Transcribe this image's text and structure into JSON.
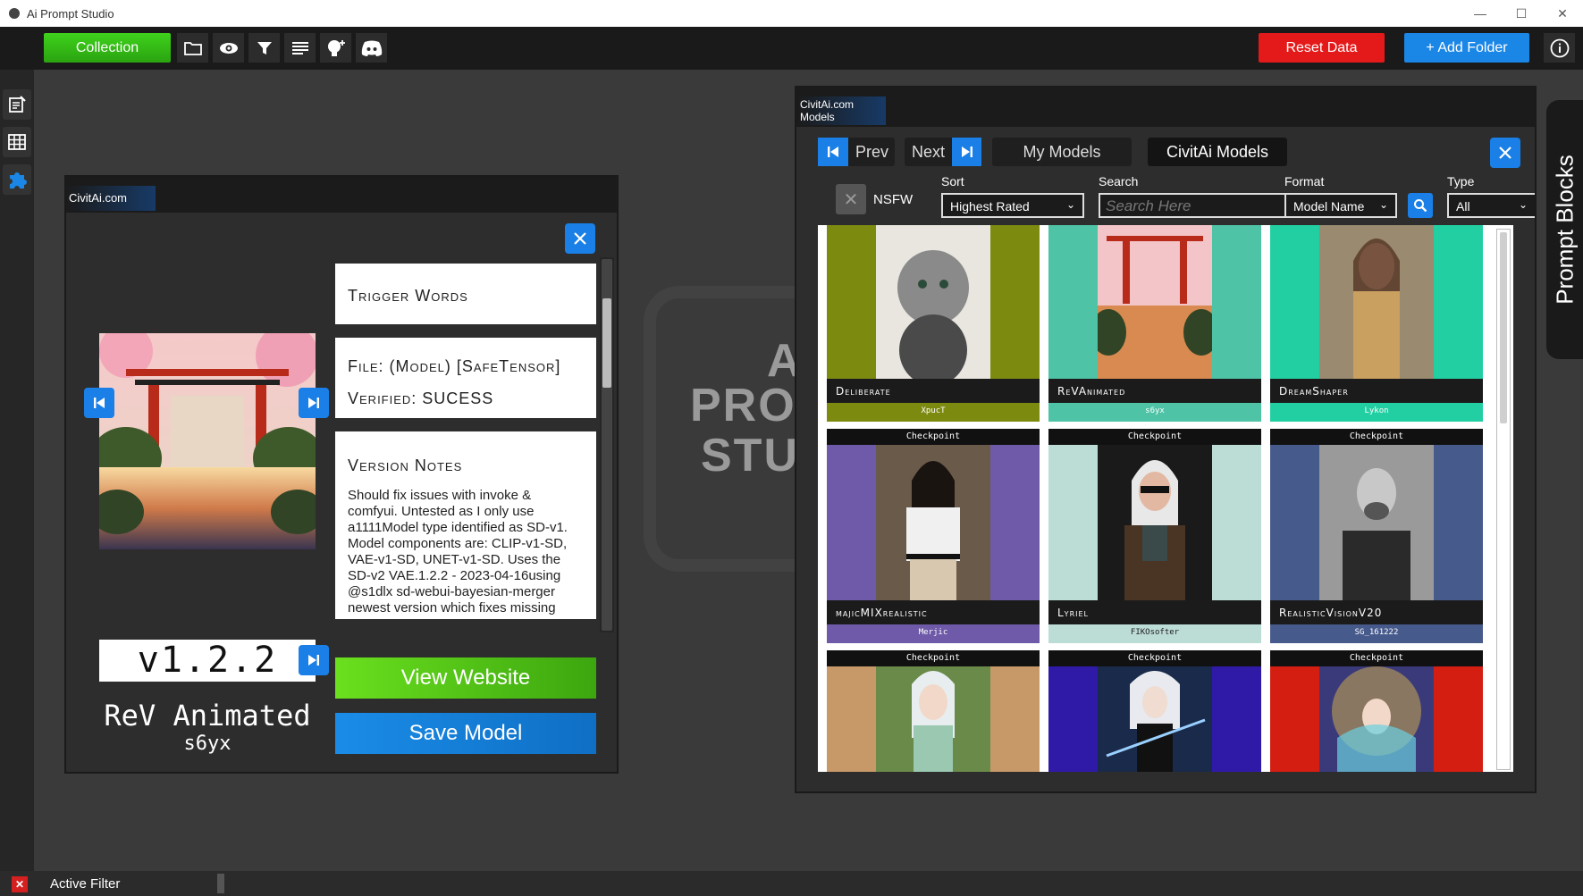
{
  "window": {
    "title": "Ai Prompt Studio"
  },
  "toolbar": {
    "collection_label": "Collection",
    "reset_label": "Reset Data",
    "add_folder_label": "+ Add Folder"
  },
  "background": {
    "logo_lines": [
      "A",
      "PRO",
      "STU"
    ]
  },
  "model_detail": {
    "panel_tab": "CivitAi.com",
    "trigger_words_title": "Trigger Words",
    "file_line": "File: (Model) [SafeTensor]",
    "verified_line": "Verified: SUCESS",
    "version_notes_title": "Version Notes",
    "version_notes_text": "Should fix issues with invoke & comfyui. Untested as I only use a1111Model type identified as SD-v1. Model components are: CLIP-v1-SD, VAE-v1-SD, UNET-v1-SD. Uses the SD-v2 VAE.1.2.2 - 2023-04-16using @s1dlx sd-webui-bayesian-merger newest version which fixes missing",
    "version": "v1.2.2",
    "model_name": "ReV Animated",
    "author": "s6yx",
    "view_website_label": "View Website",
    "save_model_label": "Save Model"
  },
  "models_browser": {
    "panel_tab": "CivitAi.com Models",
    "prev_label": "Prev",
    "next_label": "Next",
    "my_models_label": "My Models",
    "civitai_models_label": "CivitAi Models",
    "nsfw_label": "NSFW",
    "sort_label": "Sort",
    "sort_value": "Highest Rated",
    "search_label": "Search",
    "search_placeholder": "Search Here",
    "format_label": "Format",
    "format_value": "Model Name",
    "type_label": "Type",
    "type_value": "All",
    "cards": [
      {
        "type": "",
        "name": "Deliberate",
        "creator": "XpucT",
        "color": "#7d8a10"
      },
      {
        "type": "",
        "name": "ReVAnimated",
        "creator": "s6yx",
        "color": "#4ec3a6"
      },
      {
        "type": "",
        "name": "DreamShaper",
        "creator": "Lykon",
        "color": "#22cfa2"
      },
      {
        "type": "Checkpoint",
        "name": "majicMIXrealistic",
        "creator": "Merjic",
        "color": "#6e5aa8"
      },
      {
        "type": "Checkpoint",
        "name": "Lyriel",
        "creator": "FIKOsofter",
        "color": "#bcdcd6"
      },
      {
        "type": "Checkpoint",
        "name": "RealisticVisionV20",
        "creator": "SG_161222",
        "color": "#475a8c"
      },
      {
        "type": "Checkpoint",
        "name": "",
        "creator": "",
        "color": "#c89968"
      },
      {
        "type": "Checkpoint",
        "name": "",
        "creator": "",
        "color": "#2e1aa6"
      },
      {
        "type": "Checkpoint",
        "name": "",
        "creator": "",
        "color": "#d41e12"
      }
    ]
  },
  "side_tab": {
    "label": "Prompt Blocks"
  },
  "status": {
    "active_filter_label": "Active Filter"
  },
  "colors": {
    "accent_blue": "#1a7fe6",
    "reset_red": "#e41a1a",
    "collection_green": "#3fd21c"
  }
}
